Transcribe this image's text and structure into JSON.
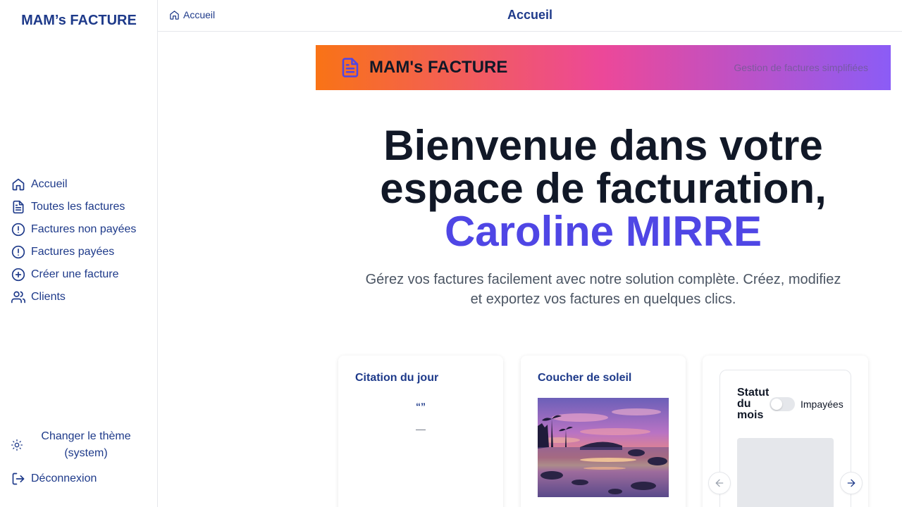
{
  "sidebar": {
    "brand": "MAM’s FACTURE",
    "items": [
      {
        "label": "Accueil",
        "icon": "home-icon"
      },
      {
        "label": "Toutes les factures",
        "icon": "file-text-icon"
      },
      {
        "label": "Factures non payées",
        "icon": "alert-circle-icon"
      },
      {
        "label": "Factures payées",
        "icon": "alert-circle-icon"
      },
      {
        "label": "Créer une facture",
        "icon": "plus-circle-icon"
      },
      {
        "label": "Clients",
        "icon": "users-icon"
      }
    ],
    "theme_label": "Changer le thème (system)",
    "logout_label": "Déconnexion"
  },
  "topbar": {
    "breadcrumb": "Accueil",
    "title": "Accueil"
  },
  "banner": {
    "title": "MAM's FACTURE",
    "subtitle": "Gestion de factures simplifiées"
  },
  "hero": {
    "line1": "Bienvenue dans votre",
    "line2": "espace de facturation,",
    "name": "Caroline MIRRE",
    "description": "Gérez vos factures facilement avec notre solution complète. Créez, modifiez et exportez vos factures en quelques clics."
  },
  "cards": {
    "quote": {
      "title": "Citation du jour",
      "quote_marks": "“”",
      "author": "—"
    },
    "sunset": {
      "title": "Coucher de soleil"
    },
    "status": {
      "title": "Statut du mois",
      "toggle_label": "Impayées",
      "toggle_on": false
    }
  },
  "colors": {
    "primary": "#1e3a8a",
    "accent": "#4f46e5",
    "banner_gradient": [
      "#f97316",
      "#ec4899",
      "#8b5cf6"
    ]
  }
}
